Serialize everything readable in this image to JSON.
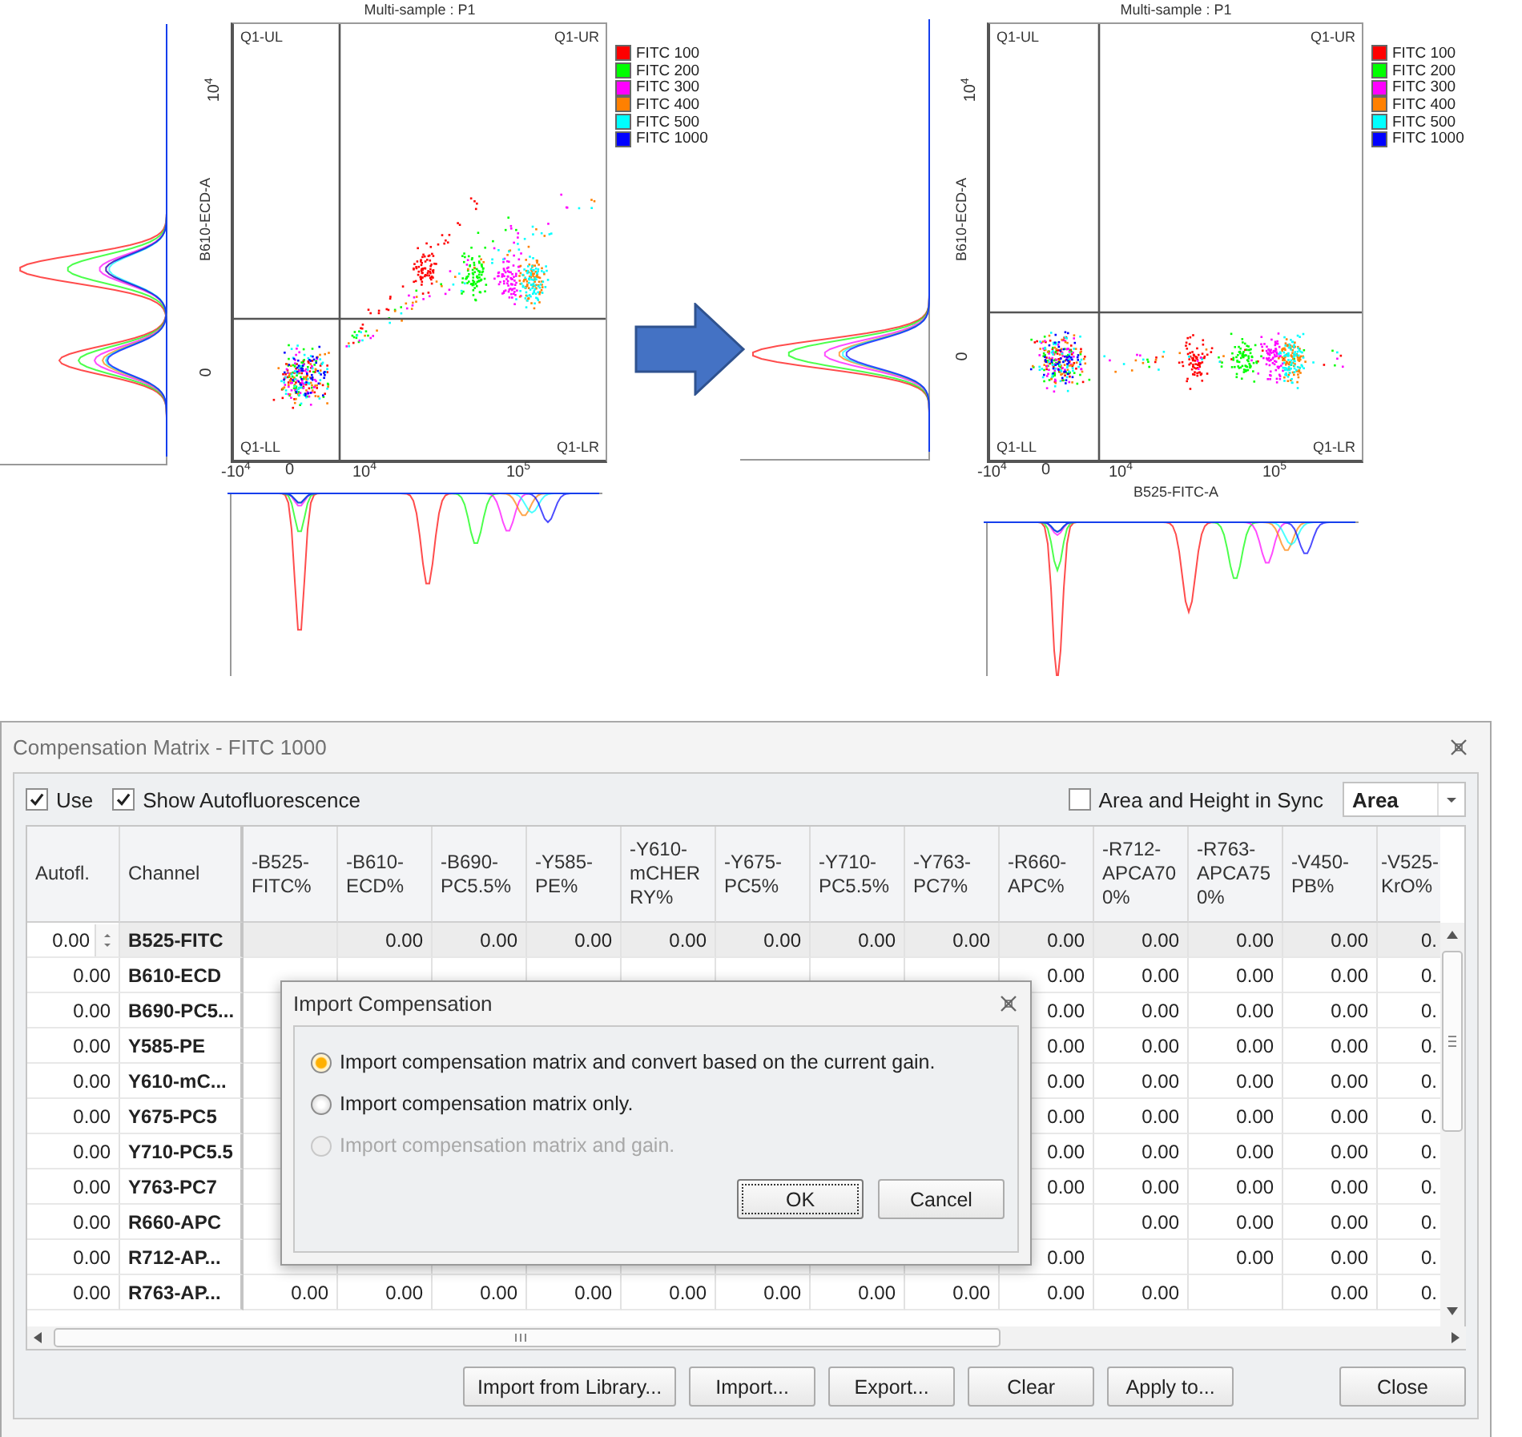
{
  "plots": [
    {
      "kind": "before",
      "title": "Multi-sample : P1",
      "quadrants": [
        "Q1-UL",
        "Q1-UR",
        "Q1-LL",
        "Q1-LR"
      ],
      "y_label": "B610-ECD-A",
      "y_ticks": [
        "10$^{4}$",
        "0"
      ],
      "x_ticks": [
        "-10$^{4}$",
        "0",
        "10$^{4}$",
        "10$^{5}$"
      ],
      "legend": [
        {
          "label": "FITC 100",
          "color": "#ff0000"
        },
        {
          "label": "FITC 200",
          "color": "#00ff00"
        },
        {
          "label": "FITC 300",
          "color": "#ff00ff"
        },
        {
          "label": "FITC 400",
          "color": "#ff8000"
        },
        {
          "label": "FITC 500",
          "color": "#00ffff"
        },
        {
          "label": "FITC 1000",
          "color": "#0000ff"
        }
      ]
    },
    {
      "kind": "after",
      "title": "Multi-sample : P1",
      "quadrants": [
        "Q1-UL",
        "Q1-UR",
        "Q1-LL",
        "Q1-LR"
      ],
      "y_label": "B610-ECD-A",
      "y_ticks": [
        "10$^{4}$",
        "0"
      ],
      "x_ticks": [
        "-10$^{4}$",
        "0",
        "10$^{4}$",
        "10$^{5}$"
      ],
      "x_label": "B525-FITC-A",
      "legend": [
        {
          "label": "FITC 100",
          "color": "#ff0000"
        },
        {
          "label": "FITC 200",
          "color": "#00ff00"
        },
        {
          "label": "FITC 300",
          "color": "#ff00ff"
        },
        {
          "label": "FITC 400",
          "color": "#ff8000"
        },
        {
          "label": "FITC 500",
          "color": "#00ffff"
        },
        {
          "label": "FITC 1000",
          "color": "#0000ff"
        }
      ]
    }
  ],
  "window": {
    "title": "Compensation Matrix - FITC 1000"
  },
  "options": [
    {
      "label": "Use",
      "checked": true
    },
    {
      "label": "Show Autofluorescence",
      "checked": true
    }
  ],
  "sync": {
    "label": "Area and Height in Sync",
    "checked": false
  },
  "mode_select": {
    "value": "Area"
  },
  "table": {
    "columns": [
      "Autofl.",
      "Channel",
      "-B525-FITC%",
      "-B610-ECD%",
      "-B690-PC5.5%",
      "-Y585-PE%",
      "-Y610-mCHERRY%",
      "-Y675-PC5%",
      "-Y710-PC5.5%",
      "-Y763-PC7%",
      "-R660-APC%",
      "-R712-APCA700%",
      "-R763-APCA750%",
      "-V450-PB%",
      "-V525-KrO%"
    ],
    "rows": [
      {
        "selected": true,
        "cells": [
          "0.00",
          "B525-FITC",
          null,
          "0.00",
          "0.00",
          "0.00",
          "0.00",
          "0.00",
          "0.00",
          "0.00",
          "0.00",
          "0.00",
          "0.00",
          "0.00",
          "0."
        ]
      },
      {
        "selected": false,
        "cells": [
          "0.00",
          "B610-ECD",
          null,
          null,
          null,
          null,
          null,
          null,
          null,
          null,
          "0.00",
          "0.00",
          "0.00",
          "0.00",
          "0."
        ]
      },
      {
        "selected": false,
        "cells": [
          "0.00",
          "B690-PC5...",
          null,
          null,
          null,
          null,
          null,
          null,
          null,
          null,
          "0.00",
          "0.00",
          "0.00",
          "0.00",
          "0."
        ]
      },
      {
        "selected": false,
        "cells": [
          "0.00",
          "Y585-PE",
          null,
          null,
          null,
          null,
          null,
          null,
          null,
          null,
          "0.00",
          "0.00",
          "0.00",
          "0.00",
          "0."
        ]
      },
      {
        "selected": false,
        "cells": [
          "0.00",
          "Y610-mC...",
          null,
          null,
          null,
          null,
          null,
          null,
          null,
          null,
          "0.00",
          "0.00",
          "0.00",
          "0.00",
          "0."
        ]
      },
      {
        "selected": false,
        "cells": [
          "0.00",
          "Y675-PC5",
          null,
          null,
          null,
          null,
          null,
          null,
          null,
          null,
          "0.00",
          "0.00",
          "0.00",
          "0.00",
          "0."
        ]
      },
      {
        "selected": false,
        "cells": [
          "0.00",
          "Y710-PC5.5",
          null,
          null,
          null,
          null,
          null,
          null,
          null,
          null,
          "0.00",
          "0.00",
          "0.00",
          "0.00",
          "0."
        ]
      },
      {
        "selected": false,
        "cells": [
          "0.00",
          "Y763-PC7",
          null,
          null,
          null,
          null,
          null,
          null,
          null,
          null,
          "0.00",
          "0.00",
          "0.00",
          "0.00",
          "0."
        ]
      },
      {
        "selected": false,
        "cells": [
          "0.00",
          "R660-APC",
          null,
          null,
          null,
          null,
          null,
          null,
          null,
          null,
          null,
          "0.00",
          "0.00",
          "0.00",
          "0."
        ]
      },
      {
        "selected": false,
        "cells": [
          "0.00",
          "R712-AP...",
          null,
          null,
          null,
          null,
          null,
          null,
          null,
          null,
          "0.00",
          null,
          "0.00",
          "0.00",
          "0."
        ]
      },
      {
        "selected": false,
        "cells": [
          "0.00",
          "R763-AP...",
          "0.00",
          "0.00",
          "0.00",
          "0.00",
          "0.00",
          "0.00",
          "0.00",
          "0.00",
          "0.00",
          "0.00",
          null,
          "0.00",
          "0."
        ]
      }
    ]
  },
  "dialog": {
    "title": "Import Compensation",
    "options": [
      {
        "label": "Import compensation matrix and convert based on the current gain.",
        "selected": true,
        "disabled": false
      },
      {
        "label": "Import compensation matrix only.",
        "selected": false,
        "disabled": false
      },
      {
        "label": "Import compensation matrix and gain.",
        "selected": false,
        "disabled": true
      }
    ],
    "buttons": [
      {
        "label": "OK",
        "focused": true
      },
      {
        "label": "Cancel",
        "focused": false
      }
    ]
  },
  "buttons": [
    "Import from Library...",
    "Import...",
    "Export...",
    "Clear",
    "Apply to..."
  ],
  "close_button": "Close"
}
